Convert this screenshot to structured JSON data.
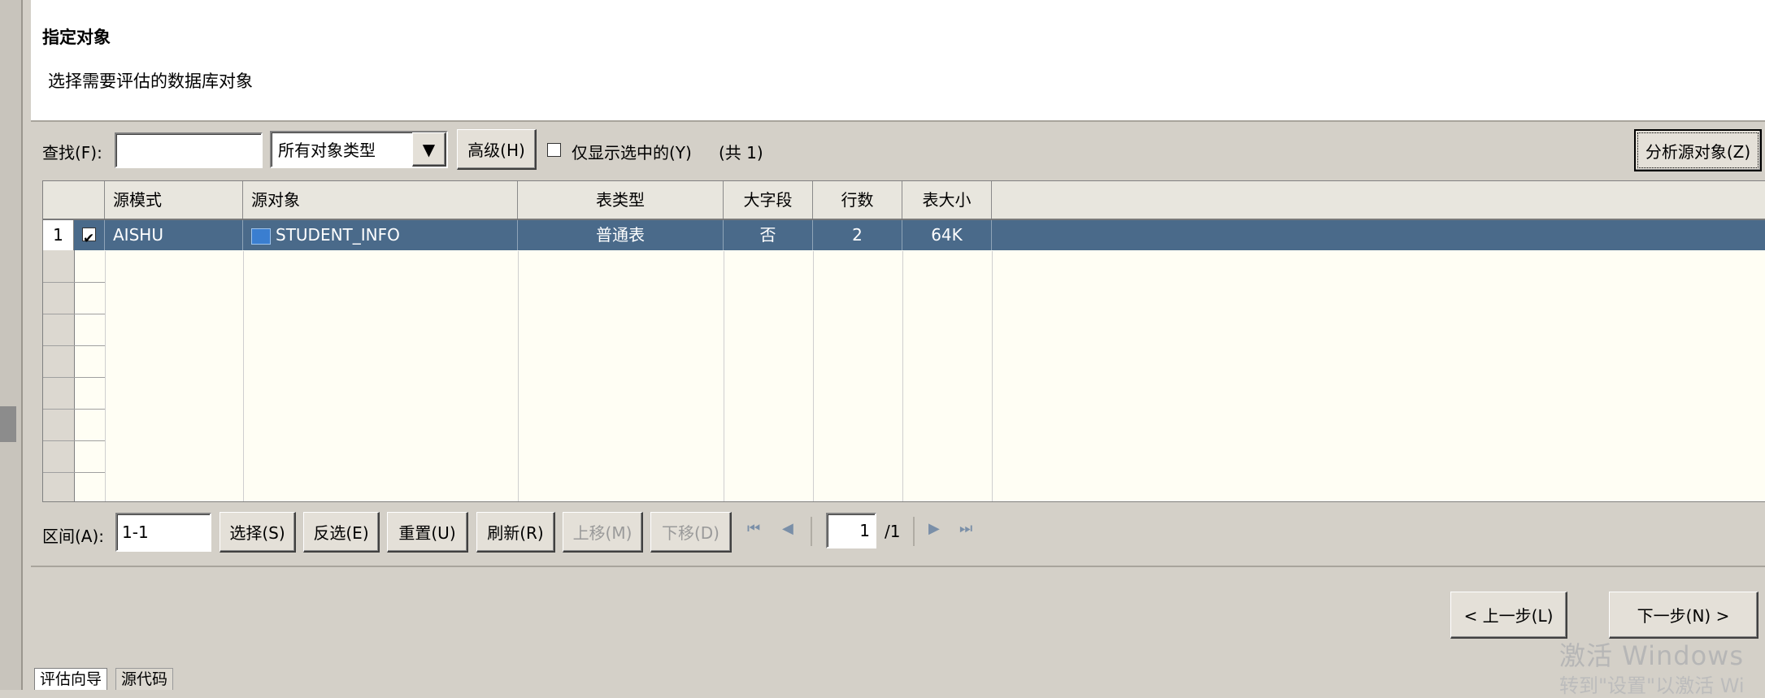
{
  "header": {
    "title": "指定对象",
    "description": "选择需要评估的数据库对象"
  },
  "toolbar": {
    "find_label": "查找(F):",
    "find_value": "",
    "type_combo_value": "所有对象类型",
    "advanced_label": "高级(H)",
    "show_selected_label": "仅显示选中的(Y)",
    "show_selected_checked": false,
    "total_label": "(共 1)",
    "analyze_label": "分析源对象(Z)"
  },
  "grid": {
    "columns": [
      "源模式",
      "源对象",
      "表类型",
      "大字段",
      "行数",
      "表大小"
    ],
    "rows": [
      {
        "num": "1",
        "checked": true,
        "schema": "AISHU",
        "object": "STUDENT_INFO",
        "table_type": "普通表",
        "lob": "否",
        "row_count": "2",
        "size": "64K"
      }
    ]
  },
  "bottom_toolbar": {
    "range_label": "区间(A):",
    "range_value": "1-1",
    "select_label": "选择(S)",
    "invert_label": "反选(E)",
    "reset_label": "重置(U)",
    "refresh_label": "刷新(R)",
    "move_up_label": "上移(M)",
    "move_down_label": "下移(D)",
    "page_value": "1",
    "page_total": "/1"
  },
  "wizard": {
    "prev_label": "< 上一步(L)",
    "next_label": "下一步(N) >"
  },
  "tabs": [
    "评估向导",
    "源代码"
  ],
  "watermark": {
    "line1": "激活 Windows",
    "line2": "转到\"设置\"以激活 Wi"
  },
  "colors": {
    "selection": "#4a6a8a",
    "window_bg": "#d4d0c8",
    "grid_bg": "#fffef4"
  }
}
